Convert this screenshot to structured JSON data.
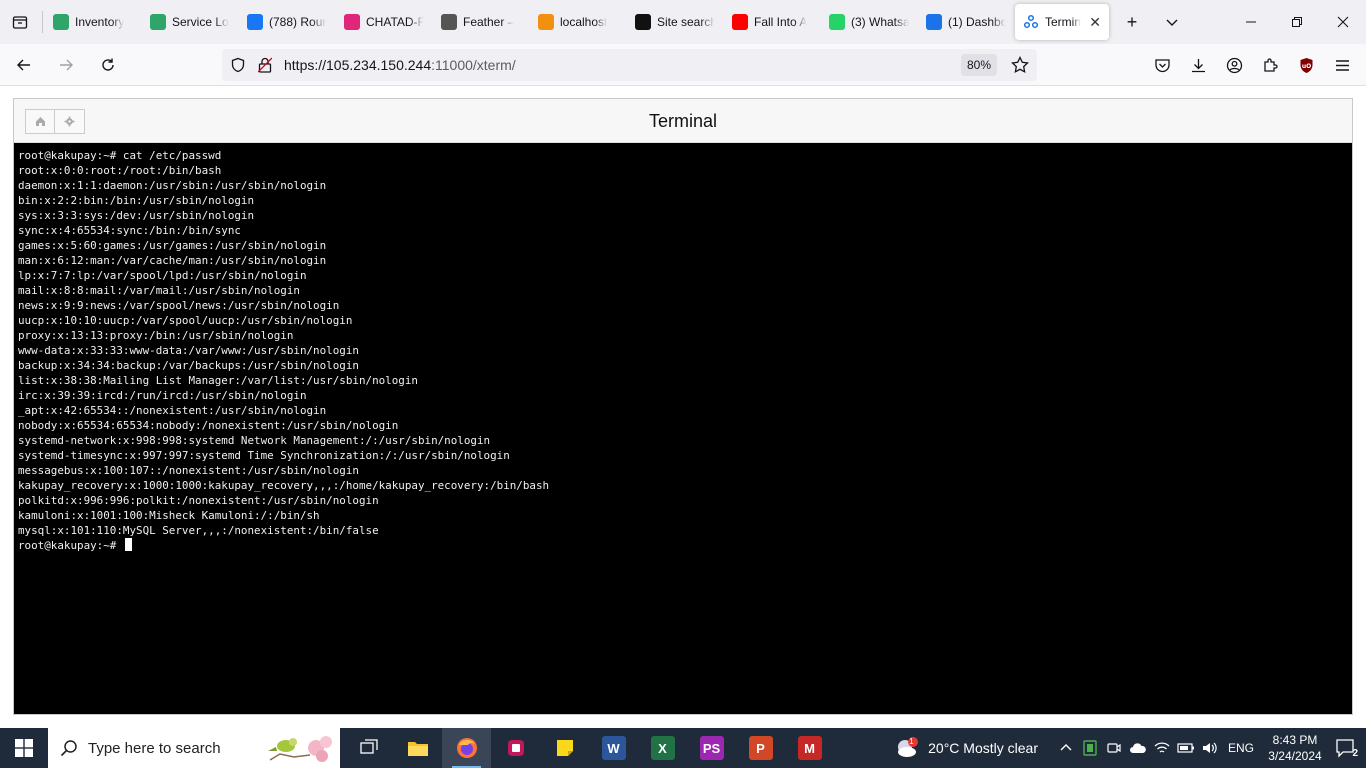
{
  "browser": {
    "tabs": [
      {
        "title": "Inventory",
        "icon": "inventory-favicon",
        "color": "#2fa56b"
      },
      {
        "title": "Service Lo",
        "icon": "service-favicon",
        "color": "#2fa56b"
      },
      {
        "title": "(788) Rour",
        "icon": "messenger-favicon",
        "color": "#1877f2"
      },
      {
        "title": "CHATAD-F",
        "icon": "chatad-favicon",
        "color": "#e0267a"
      },
      {
        "title": "Feather –",
        "icon": "feather-favicon",
        "color": "#555555"
      },
      {
        "title": "localhost",
        "icon": "phpmyadmin-favicon",
        "color": "#f29111"
      },
      {
        "title": "Site search",
        "icon": "ci-favicon",
        "color": "#111111"
      },
      {
        "title": "Fall Into A",
        "icon": "youtube-favicon",
        "color": "#ff0000"
      },
      {
        "title": "(3) Whatsa",
        "icon": "whatsapp-favicon",
        "color": "#25d366"
      },
      {
        "title": "(1) Dashbo",
        "icon": "dashboard-favicon",
        "color": "#1a73e8"
      }
    ],
    "active_tab": {
      "title": "Termin",
      "icon": "terminal-favicon",
      "color": "#1a73e8",
      "close": "✕"
    },
    "new_tab": "+",
    "list_tabs": "⌄",
    "url_host": "https://105.234.150.244",
    "url_rest": ":11000/xterm/",
    "zoom": "80%"
  },
  "terminal": {
    "title": "Terminal",
    "lines": [
      "root@kakupay:~# cat /etc/passwd",
      "root:x:0:0:root:/root:/bin/bash",
      "daemon:x:1:1:daemon:/usr/sbin:/usr/sbin/nologin",
      "bin:x:2:2:bin:/bin:/usr/sbin/nologin",
      "sys:x:3:3:sys:/dev:/usr/sbin/nologin",
      "sync:x:4:65534:sync:/bin:/bin/sync",
      "games:x:5:60:games:/usr/games:/usr/sbin/nologin",
      "man:x:6:12:man:/var/cache/man:/usr/sbin/nologin",
      "lp:x:7:7:lp:/var/spool/lpd:/usr/sbin/nologin",
      "mail:x:8:8:mail:/var/mail:/usr/sbin/nologin",
      "news:x:9:9:news:/var/spool/news:/usr/sbin/nologin",
      "uucp:x:10:10:uucp:/var/spool/uucp:/usr/sbin/nologin",
      "proxy:x:13:13:proxy:/bin:/usr/sbin/nologin",
      "www-data:x:33:33:www-data:/var/www:/usr/sbin/nologin",
      "backup:x:34:34:backup:/var/backups:/usr/sbin/nologin",
      "list:x:38:38:Mailing List Manager:/var/list:/usr/sbin/nologin",
      "irc:x:39:39:ircd:/run/ircd:/usr/sbin/nologin",
      "_apt:x:42:65534::/nonexistent:/usr/sbin/nologin",
      "nobody:x:65534:65534:nobody:/nonexistent:/usr/sbin/nologin",
      "systemd-network:x:998:998:systemd Network Management:/:/usr/sbin/nologin",
      "systemd-timesync:x:997:997:systemd Time Synchronization:/:/usr/sbin/nologin",
      "messagebus:x:100:107::/nonexistent:/usr/sbin/nologin",
      "kakupay_recovery:x:1000:1000:kakupay_recovery,,,:/home/kakupay_recovery:/bin/bash",
      "polkitd:x:996:996:polkit:/nonexistent:/usr/sbin/nologin",
      "kamuloni:x:1001:100:Misheck Kamuloni:/:/bin/sh",
      "mysql:x:101:110:MySQL Server,,,:/nonexistent:/bin/false"
    ],
    "prompt": "root@kakupay:~# "
  },
  "taskbar": {
    "search_placeholder": "Type here to search",
    "apps": [
      {
        "name": "task-view",
        "label": "",
        "color": "#1f2a3a"
      },
      {
        "name": "file-explorer",
        "label": "",
        "color": "#f4c430"
      },
      {
        "name": "firefox",
        "label": "",
        "color": "#ff7139",
        "active": true
      },
      {
        "name": "app-purple",
        "label": "",
        "color": "#c2185b"
      },
      {
        "name": "sticky-notes",
        "label": "",
        "color": "#f9d71c"
      },
      {
        "name": "word",
        "label": "W",
        "color": "#2b579a"
      },
      {
        "name": "excel",
        "label": "X",
        "color": "#217346"
      },
      {
        "name": "phpstorm",
        "label": "PS",
        "color": "#9c27b0"
      },
      {
        "name": "powerpoint",
        "label": "P",
        "color": "#d24726"
      },
      {
        "name": "app-m",
        "label": "M",
        "color": "#c62828"
      }
    ],
    "weather_badge": "1",
    "weather": "20°C  Mostly clear",
    "language": "ENG",
    "time": "8:43 PM",
    "date": "3/24/2024",
    "notifications": "2"
  }
}
